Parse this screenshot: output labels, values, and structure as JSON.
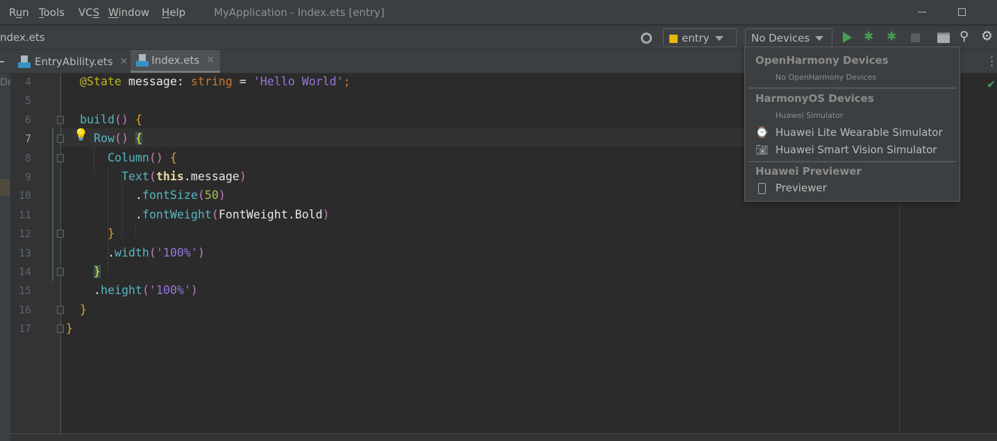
{
  "menu": {
    "items": [
      "Run",
      "Tools",
      "VCS",
      "Window",
      "Help"
    ],
    "mnemonic": [
      "u",
      "T",
      "S",
      "W",
      "H"
    ]
  },
  "window_title": "MyApplication - Index.ets [entry]",
  "breadcrumb": "ndex.ets",
  "toolbar": {
    "module": "entry",
    "device": "No Devices"
  },
  "tabs": [
    {
      "label": "EntryAbility.ets",
      "active": false
    },
    {
      "label": "Index.ets",
      "active": true
    }
  ],
  "gutter_partial_label": "De",
  "editor": {
    "current_line": 7,
    "lines": [
      {
        "n": 4,
        "t": [
          [
            "  ",
            ""
          ],
          [
            "@State",
            "ann"
          ],
          [
            " message: ",
            "w"
          ],
          [
            "string",
            "kw"
          ],
          [
            " = ",
            "w"
          ],
          [
            "'Hello World'",
            "str"
          ],
          [
            ";",
            "kw"
          ]
        ]
      },
      {
        "n": 5,
        "t": []
      },
      {
        "n": 6,
        "t": [
          [
            "  ",
            ""
          ],
          [
            "build",
            "fn"
          ],
          [
            "()",
            "par"
          ],
          [
            " ",
            ""
          ],
          [
            "{",
            "br"
          ]
        ]
      },
      {
        "n": 7,
        "t": [
          [
            "    ",
            ""
          ],
          [
            "Row",
            "fn"
          ],
          [
            "()",
            "par"
          ],
          [
            " ",
            ""
          ],
          [
            "{",
            "brm"
          ]
        ]
      },
      {
        "n": 8,
        "t": [
          [
            "      ",
            ""
          ],
          [
            "Column",
            "fn"
          ],
          [
            "()",
            "par"
          ],
          [
            " ",
            ""
          ],
          [
            "{",
            "br"
          ]
        ]
      },
      {
        "n": 9,
        "t": [
          [
            "        ",
            ""
          ],
          [
            "Text",
            "fn"
          ],
          [
            "(",
            "par"
          ],
          [
            "this",
            "this"
          ],
          [
            ".message",
            "w"
          ],
          [
            ")",
            "par"
          ]
        ]
      },
      {
        "n": 10,
        "t": [
          [
            "          ",
            ""
          ],
          [
            ".",
            "w"
          ],
          [
            "fontSize",
            "fn"
          ],
          [
            "(",
            "par"
          ],
          [
            "50",
            "num"
          ],
          [
            ")",
            "par"
          ]
        ]
      },
      {
        "n": 11,
        "t": [
          [
            "          ",
            ""
          ],
          [
            ".",
            "w"
          ],
          [
            "fontWeight",
            "fn"
          ],
          [
            "(",
            "par"
          ],
          [
            "FontWeight.Bold",
            "w"
          ],
          [
            ")",
            "par"
          ]
        ]
      },
      {
        "n": 12,
        "t": [
          [
            "      ",
            ""
          ],
          [
            "}",
            "br"
          ]
        ]
      },
      {
        "n": 13,
        "t": [
          [
            "      ",
            ""
          ],
          [
            ".",
            "w"
          ],
          [
            "width",
            "fn"
          ],
          [
            "(",
            "par"
          ],
          [
            "'100%'",
            "str"
          ],
          [
            ")",
            "par"
          ]
        ]
      },
      {
        "n": 14,
        "t": [
          [
            "    ",
            ""
          ],
          [
            "}",
            "brm"
          ]
        ]
      },
      {
        "n": 15,
        "t": [
          [
            "    ",
            ""
          ],
          [
            ".",
            "w"
          ],
          [
            "height",
            "fn"
          ],
          [
            "(",
            "par"
          ],
          [
            "'100%'",
            "str"
          ],
          [
            ")",
            "par"
          ]
        ]
      },
      {
        "n": 16,
        "t": [
          [
            "  ",
            ""
          ],
          [
            "}",
            "br"
          ]
        ]
      },
      {
        "n": 17,
        "t": [
          [
            "}",
            "br"
          ]
        ]
      }
    ]
  },
  "colors": {
    "ann": "#bbb529",
    "w": "#e8e8e8",
    "kw": "#cc7832",
    "str": "#9876d9",
    "fn": "#56b6c2",
    "par": "#c77dbb",
    "br": "#e0a030",
    "brm": "#e8e84a",
    "this": "#e8d6a0",
    "num": "#a5c25c",
    "accent_green": "#499c54"
  },
  "device_dropdown": {
    "sections": [
      {
        "header": "OpenHarmony Devices",
        "subtitle": "No OpenHarmony Devices",
        "items": []
      },
      {
        "header": "HarmonyOS Devices",
        "subtitle": "Huawei Simulator",
        "items": [
          {
            "label": "Huawei Lite Wearable Simulator",
            "icon": "watch-icon"
          },
          {
            "label": "Huawei Smart Vision Simulator",
            "icon": "camera-icon"
          }
        ]
      },
      {
        "header": "Huawei Previewer",
        "items": [
          {
            "label": "Previewer",
            "icon": "phone-icon"
          }
        ]
      }
    ]
  }
}
